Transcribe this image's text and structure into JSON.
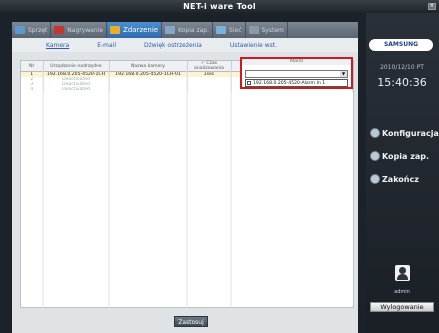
{
  "window": {
    "title": "NET-i ware Tool"
  },
  "tabs": [
    {
      "label": "Sprzęt",
      "color": "#5d98cf"
    },
    {
      "label": "Nagrywanie",
      "color": "#c4362f"
    },
    {
      "label": "Zdarzenie",
      "color": "#e9ae26"
    },
    {
      "label": "Kopia zap.",
      "color": "#83a6c9"
    },
    {
      "label": "Sieć",
      "color": "#7bb0d8"
    },
    {
      "label": "System",
      "color": "#8b98a5"
    }
  ],
  "subtabs": [
    "Kamera",
    "E-mail",
    "Dźwięk ostrzeżenia",
    "Ustawienie wst."
  ],
  "grid": {
    "headers": [
      "Nr",
      "Urządzenie nadrzędne",
      "Nazwa kamery",
      "✓ Czas analizowania",
      "Alarm"
    ],
    "rows": [
      [
        "1",
        "192.168.0.205-4520-1CH",
        "192.168.0.205-4520-1CH-01",
        "1sec",
        ""
      ],
      [
        "2",
        "Deactivated",
        "",
        "",
        ""
      ],
      [
        "3",
        "Deactivated",
        "",
        "",
        ""
      ],
      [
        "4",
        "Deactivated",
        "",
        "",
        ""
      ]
    ]
  },
  "alarm": {
    "header": "Alarm",
    "option": "192.168.0.205-4520-Alarm In 1"
  },
  "apply_label": "Zastosuj",
  "sidebar": {
    "logo": "SAMSUNG",
    "date": "2010/12/10 PT",
    "time": "15:40:36",
    "config": "Konfiguracja",
    "backup": "Kopia zap.",
    "exit": "Zakończ",
    "user": "admin",
    "logout": "Wylogowanie"
  }
}
